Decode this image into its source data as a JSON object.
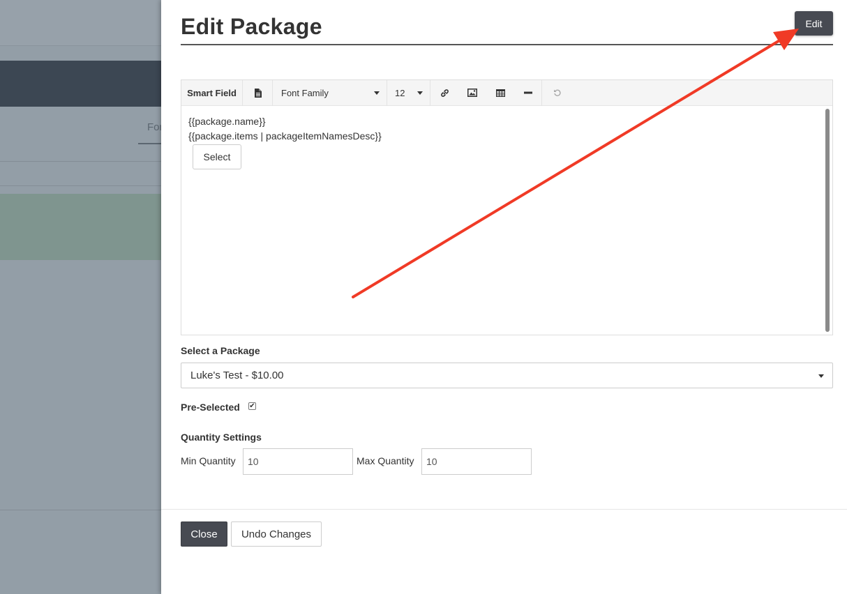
{
  "background": {
    "tab_fragment": "For"
  },
  "modal": {
    "title": "Edit Package",
    "edit_label": "Edit"
  },
  "editor": {
    "toolbar": {
      "smart_field": "Smart Field",
      "font_family": "Font Family",
      "font_size": "12",
      "icons": [
        "document-icon",
        "link-icon",
        "image-icon",
        "table-icon",
        "horizontal-rule-icon",
        "undo-icon"
      ]
    },
    "content": {
      "line1": "{{package.name}}",
      "line2": "{{package.items | packageItemNamesDesc}}",
      "select_label": "Select"
    }
  },
  "package": {
    "label": "Select a Package",
    "selected": "Luke's Test - $10.00"
  },
  "preselected": {
    "label": "Pre-Selected",
    "checked": true
  },
  "quantity": {
    "heading": "Quantity Settings",
    "min_label": "Min Quantity",
    "min_value": "10",
    "max_label": "Max Quantity",
    "max_value": "10"
  },
  "footer": {
    "close_label": "Close",
    "undo_label": "Undo Changes"
  },
  "colors": {
    "annotation_arrow": "#f03a26",
    "primary_button": "#474a52"
  }
}
